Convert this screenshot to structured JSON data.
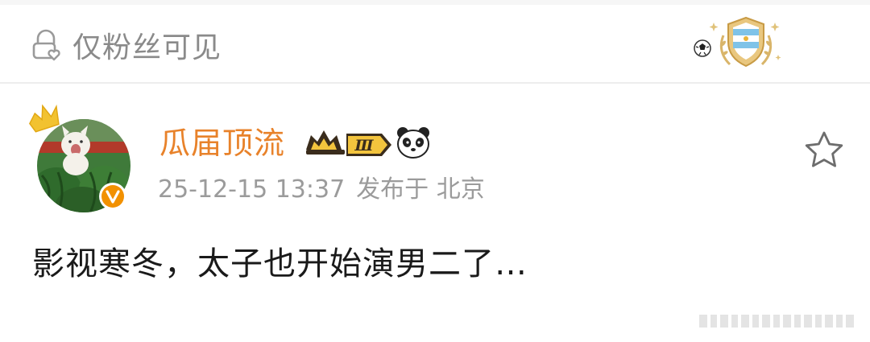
{
  "visibility": {
    "label": "仅粉丝可见",
    "icon": "lock-heart-icon"
  },
  "badge": {
    "icon": "argentina-shield-badge-icon"
  },
  "post": {
    "username": "瓜届顶流",
    "vip_level": "Ⅲ",
    "date": "25-12-15 13:37",
    "location": "发布于 北京",
    "text": "影视寒冬，太子也开始演男二了…"
  },
  "colors": {
    "username": "#e8822a",
    "meta": "#9b9b9b",
    "text": "#1a1a1a",
    "verified": "#f29100"
  }
}
